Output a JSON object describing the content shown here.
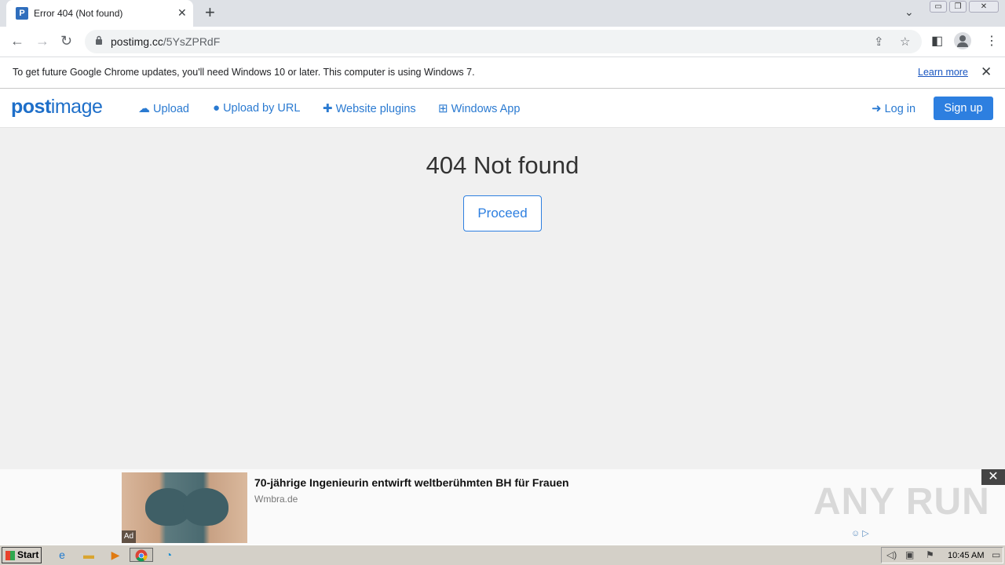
{
  "browser": {
    "tab_title": "Error 404 (Not found)",
    "tab_favicon_letter": "P",
    "url_domain": "postimg.cc",
    "url_path": "/5YsZPRdF"
  },
  "infobar": {
    "message": "To get future Google Chrome updates, you'll need Windows 10 or later. This computer is using Windows 7.",
    "link": "Learn more"
  },
  "site": {
    "logo_bold": "post",
    "logo_rest": "image",
    "nav": [
      {
        "label": "Upload",
        "icon": "cloud-upload-icon"
      },
      {
        "label": "Upload by URL",
        "icon": "globe-icon"
      },
      {
        "label": "Website plugins",
        "icon": "puzzle-icon"
      },
      {
        "label": "Windows App",
        "icon": "windows-icon"
      }
    ],
    "login": "Log in",
    "signup": "Sign up"
  },
  "main": {
    "title": "404 Not found",
    "proceed": "Proceed"
  },
  "ad": {
    "title": "70-jährige Ingenieurin entwirft weltberühmten BH für Frauen",
    "source": "Wmbra.de",
    "badge": "Ad",
    "watermark": "ANY RUN"
  },
  "taskbar": {
    "start": "Start",
    "clock": "10:45 AM"
  },
  "colors": {
    "brand": "#1e6fc9",
    "accent": "#2d7fe0"
  }
}
